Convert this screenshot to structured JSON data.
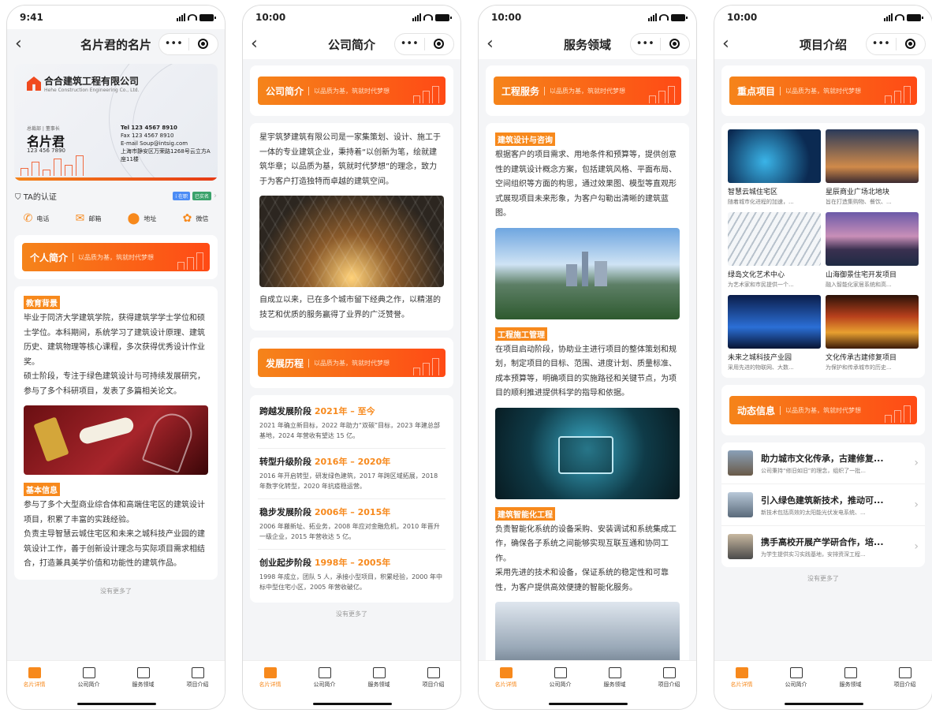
{
  "tab_labels": [
    "名片详情",
    "公司简介",
    "服务领域",
    "项目介绍"
  ],
  "banner_slogan": "以品质为基，筑就时代梦想",
  "no_more": "没有更多了",
  "colors": {
    "accent": "#f7891c",
    "banner_start": "#f5841a",
    "banner_end": "#ff4a15"
  },
  "screen1": {
    "time": "9:41",
    "title": "名片君的名片",
    "card": {
      "company": "合合建筑工程有限公司",
      "company_en": "Hehe Construction Engineering Co., Ltd.",
      "role": "总裁部 | 董事长",
      "name": "名片君",
      "phone": "123 456 7890",
      "tel": "Tel  123 4567 8910",
      "fax": "Fax  123 4567 8910",
      "email": "E-mail  Soup@intsig.com",
      "address": "上海市静安区万荣路1268号云立方A座11楼"
    },
    "verify_label": "TA的认证",
    "verify_badges": [
      "i 在职",
      "已实名"
    ],
    "contacts": [
      "电话",
      "邮箱",
      "地址",
      "微信"
    ],
    "section_title": "个人简介",
    "edu_tag": "教育背景",
    "edu_text_1": "毕业于同济大学建筑学院，获得建筑学学士学位和硕士学位。本科期间，系统学习了建筑设计原理、建筑历史、建筑物理等核心课程，多次获得优秀设计作业奖。",
    "edu_text_2": "硕士阶段，专注于绿色建筑设计与可持续发展研究，参与了多个科研项目，发表了多篇相关论文。",
    "basic_tag": "基本信息",
    "basic_text_1": "参与了多个大型商业综合体和高端住宅区的建筑设计项目，积累了丰富的实践经验。",
    "basic_text_2": "负责主导智慧云城住宅区和未来之城科技产业园的建筑设计工作，善于创新设计理念与实际项目需求相结合，打造兼具美学价值和功能性的建筑作品。"
  },
  "screen2": {
    "time": "10:00",
    "title": "公司简介",
    "section_title": "公司简介",
    "intro": "星宇筑梦建筑有限公司是一家集策划、设计、施工于一体的专业建筑企业，秉持着“以创新为笔，绘就建筑华章；以品质为基，筑就时代梦想”的理念，致力于为客户打造独特而卓越的建筑空间。",
    "intro_2": "自成立以来，已在多个城市留下经典之作，以精湛的技艺和优质的服务赢得了业界的广泛赞誉。",
    "history_title": "发展历程",
    "stages": [
      {
        "name": "跨越发展阶段",
        "period": "2021年 – 至今",
        "desc": "2021 年确立新目标，2022 年助力“双碳”目标，2023 年建总部基地，2024 年营收有望达 15 亿。"
      },
      {
        "name": "转型升级阶段",
        "period": "2016年 – 2020年",
        "desc": "2016 年开启转型，研发绿色建筑，2017 年跨区域拓展，2018 年数字化转型，2020 年抗疫稳运营。"
      },
      {
        "name": "稳步发展阶段",
        "period": "2006年 – 2015年",
        "desc": "2006 年搬新址、拓业务，2008 年应对金融危机，2010 年晋升一级企业，2015 年营收达 5 亿。"
      },
      {
        "name": "创业起步阶段",
        "period": "1998年 – 2005年",
        "desc": "1998 年成立，团队 5 人，承接小型项目，积累经验，2000 年中标中型住宅小区，2005 年营收破亿。"
      }
    ]
  },
  "screen3": {
    "time": "10:00",
    "title": "服务领域",
    "section_title": "工程服务",
    "s1_tag": "建筑设计与咨询",
    "s1_text": "根据客户的项目需求、用地条件和预算等，提供创意性的建筑设计概念方案，包括建筑风格、平面布局、空间组织等方面的构思，通过效果图、模型等直观形式展现项目未来形象，为客户勾勒出清晰的建筑蓝图。",
    "s2_tag": "工程施工管理",
    "s2_text": "在项目启动阶段，协助业主进行项目的整体策划和规划，制定项目的目标、范围、进度计划、质量标准、成本预算等，明确项目的实施路径和关键节点，为项目的顺利推进提供科学的指导和依据。",
    "s3_tag": "建筑智能化工程",
    "s3_text": "负责智能化系统的设备采购、安装调试和系统集成工作，确保各子系统之间能够实现互联互通和协同工作。",
    "s3_text_2": "采用先进的技术和设备，保证系统的稳定性和可靠性，为客户提供高效便捷的智能化服务。"
  },
  "screen4": {
    "time": "10:00",
    "title": "项目介绍",
    "section_title": "重点项目",
    "projects": [
      {
        "name": "智慧云城住宅区",
        "desc": "随着城市化进程的加速，..."
      },
      {
        "name": "星辰商业广场北地块",
        "desc": "旨在打造集购物、餐饮、..."
      },
      {
        "name": "绿岛文化艺术中心",
        "desc": "为艺术家和市民提供一个..."
      },
      {
        "name": "山海御景住宅开发项目",
        "desc": "融入智能化家居系统和高..."
      },
      {
        "name": "未来之城科技产业园",
        "desc": "采用先进的物联网、大数..."
      },
      {
        "name": "文化传承古建修复项目",
        "desc": "为保护和传承城市的历史..."
      }
    ],
    "news_title": "动态信息",
    "news": [
      {
        "title": "助力城市文化传承，古建修复...",
        "desc": "公司秉持“修旧如旧”的理念，组织了一批..."
      },
      {
        "title": "引入绿色建筑新技术，推动可...",
        "desc": "新技术包括高效的太阳能光伏发电系统、..."
      },
      {
        "title": "携手高校开展产学研合作，培...",
        "desc": "为学生提供实习实践基地，安排资深工程..."
      }
    ]
  }
}
